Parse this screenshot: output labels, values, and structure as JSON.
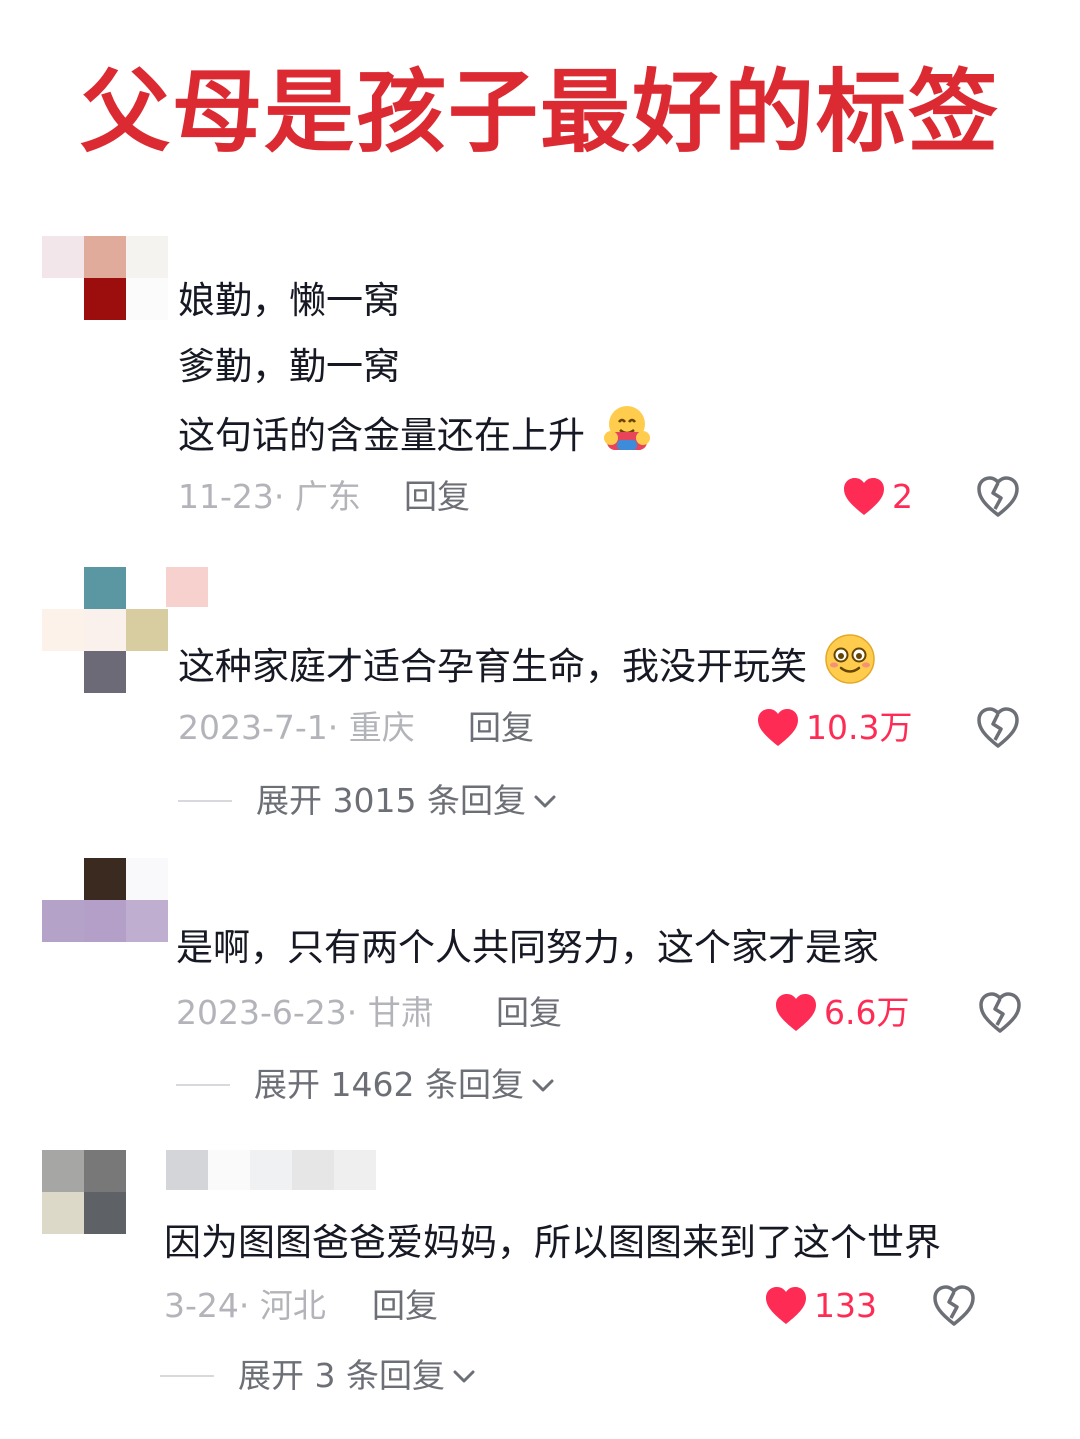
{
  "page_title": "父母是孩子最好的标签",
  "colors": {
    "title": "#dc2a33",
    "like": "#fe2c55",
    "text": "#161823",
    "meta": "#b3b4b9",
    "reply": "#6d6f77"
  },
  "comments": [
    {
      "lines": [
        "娘勤，懒一窝",
        "爹勤，勤一窝",
        "这句话的含金量还在上升"
      ],
      "emoji": "hugging-face-icon",
      "date_location": "11-23· 广东",
      "reply_label": "回复",
      "likes": "2"
    },
    {
      "lines": [
        "这种家庭才适合孕育生命，我没开玩笑"
      ],
      "emoji": "smiling-face-icon",
      "date_location": "2023-7-1· 重庆",
      "reply_label": "回复",
      "likes": "10.3万",
      "expand_label": "展开 3015 条回复"
    },
    {
      "lines": [
        "是啊，只有两个人共同努力，这个家才是家"
      ],
      "date_location": "2023-6-23· 甘肃",
      "reply_label": "回复",
      "likes": "6.6万",
      "expand_label": "展开 1462 条回复"
    },
    {
      "lines": [
        "因为图图爸爸爱妈妈，所以图图来到了这个世界"
      ],
      "date_location": "3-24· 河北",
      "reply_label": "回复",
      "likes": "133",
      "expand_label": "展开 3 条回复"
    }
  ]
}
